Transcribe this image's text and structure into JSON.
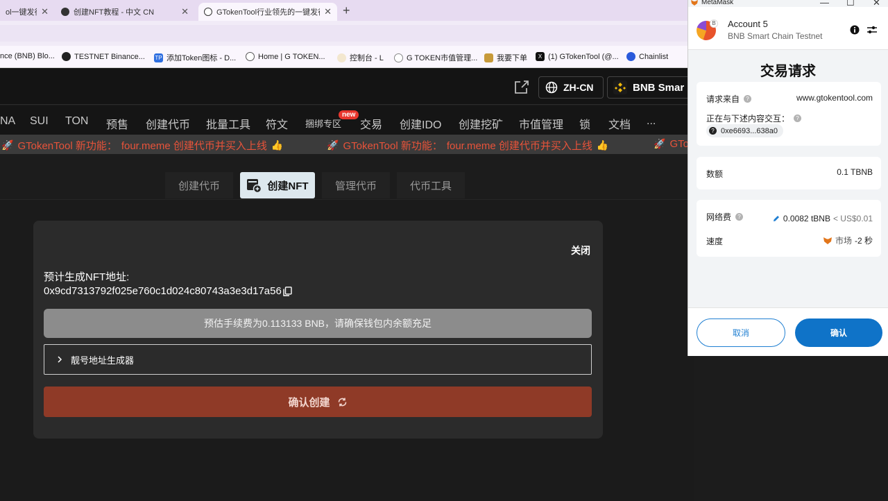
{
  "browser": {
    "tabs": [
      {
        "label": "ol一键发行",
        "icon": "t"
      },
      {
        "label": "创建NFT教程 - 中文 CN",
        "icon": "g"
      },
      {
        "label": "GTokenTool行业领先的一键发行",
        "icon": "g"
      }
    ],
    "new_tab": "+",
    "bookmarks": [
      {
        "label": "nce (BNB) Blo...",
        "color": "#f0b90b",
        "icon": ""
      },
      {
        "label": "TESTNET Binance...",
        "color": "#222222",
        "icon": ""
      },
      {
        "label": "添加Token图标 - D...",
        "color": "#2f6fe0",
        "icon": "TP"
      },
      {
        "label": "Home | G TOKEN...",
        "color": "#555555",
        "icon": ""
      },
      {
        "label": "控制台 - L",
        "color": "#d9a84a",
        "icon": ""
      },
      {
        "label": "G TOKEN市值管理...",
        "color": "#777777",
        "icon": ""
      },
      {
        "label": "我要下单",
        "color": "#c79a3a",
        "icon": ""
      },
      {
        "label": "(1) GTokenTool (@...",
        "color": "#111111",
        "icon": "X"
      },
      {
        "label": "Chainlist",
        "color": "#2a5adb",
        "icon": ""
      }
    ]
  },
  "site": {
    "lang": "ZH-CN",
    "chain": "BNB Smar",
    "nav": [
      "NA",
      "SUI",
      "TON",
      "预售",
      "创建代币",
      "批量工具",
      "符文",
      "捆绑专区",
      "交易",
      "创建IDO",
      "创建挖矿",
      "市值管理",
      "锁",
      "文档",
      "..."
    ],
    "new_badge": "new",
    "ticker": [
      {
        "brand": "GTokenTool 新功能：",
        "text": "four.meme 创建代币并买入上线"
      },
      {
        "brand": "GTokenTool 新功能：",
        "text": "four.meme 创建代币并买入上线"
      },
      {
        "brand": "GTo",
        "text": ""
      }
    ],
    "subtabs": [
      "创建代币",
      "创建NFT",
      "管理代币",
      "代币工具"
    ],
    "card": {
      "close": "关闭",
      "predict_label": "预计生成NFT地址:",
      "predict_address": "0x9cd7313792f025e760c1d024c80743a3e3d17a56",
      "fee_notice": "预估手续费为0.113133 BNB，请确保钱包内余额充足",
      "vanity": "靓号地址生成器",
      "confirm": "确认创建"
    }
  },
  "metamask": {
    "window_title": "MetaMask",
    "account_name": "Account 5",
    "account_badge": "B",
    "network": "BNB Smart Chain Testnet",
    "heading": "交易请求",
    "origin_label": "请求来自",
    "origin_value": "www.gtokentool.com",
    "interact_label": "正在与下述内容交互：",
    "contract": "0xe6693...638a0",
    "amount_label": "数额",
    "amount_value": "0.1 TBNB",
    "fee_label": "网络费",
    "fee_value": "0.0082 tBNB",
    "fee_fiat": "< US$0.01",
    "speed_label": "速度",
    "speed_value": "市场",
    "speed_eta": "-2 秒",
    "cancel": "取消",
    "confirm": "确认"
  }
}
